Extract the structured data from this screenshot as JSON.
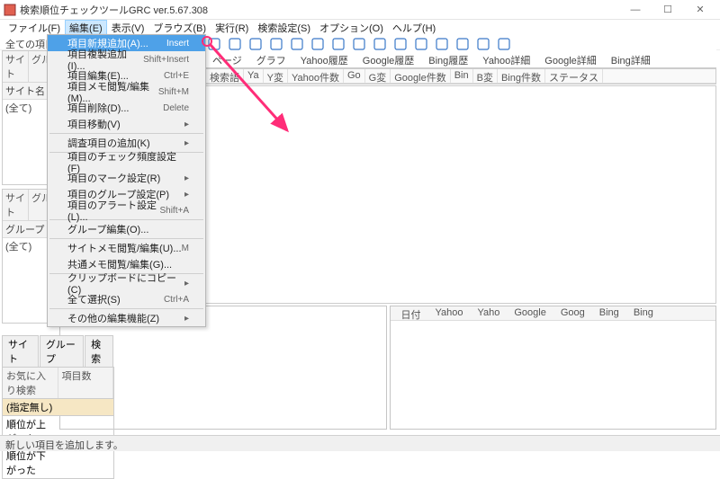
{
  "window": {
    "title": "検索順位チェックツールGRC  ver.5.67.308",
    "min": "—",
    "max": "☐",
    "close": "✕"
  },
  "menu": {
    "items": [
      "ファイル(F)",
      "編集(E)",
      "表示(V)",
      "ブラウズ(B)",
      "実行(R)",
      "検索設定(S)",
      "オプション(O)",
      "ヘルプ(H)"
    ],
    "active_index": 1
  },
  "infobar": "全ての項目",
  "edit_menu": [
    {
      "label": "項目新規追加(A)...",
      "shortcut": "Insert",
      "hl": true
    },
    {
      "label": "項目複製追加(I)...",
      "shortcut": "Shift+Insert"
    },
    {
      "label": "項目編集(E)...",
      "shortcut": "Ctrl+E"
    },
    {
      "label": "項目メモ閲覧/編集(M)...",
      "shortcut": "Shift+M"
    },
    {
      "label": "項目削除(D)...",
      "shortcut": "Delete"
    },
    {
      "label": "項目移動(V)",
      "arrow": true
    },
    {
      "sep": true
    },
    {
      "label": "調査項目の追加(K)",
      "arrow": true
    },
    {
      "sep": true
    },
    {
      "label": "項目のチェック頻度設定(F)"
    },
    {
      "label": "項目のマーク設定(R)",
      "arrow": true
    },
    {
      "label": "項目のグループ設定(P)",
      "arrow": true
    },
    {
      "label": "項目のアラート設定(L)...",
      "shortcut": "Shift+A"
    },
    {
      "sep": true
    },
    {
      "label": "グループ編集(O)..."
    },
    {
      "sep": true
    },
    {
      "label": "サイトメモ閲覧/編集(U)...",
      "shortcut": "M"
    },
    {
      "label": "共通メモ閲覧/編集(G)..."
    },
    {
      "sep": true
    },
    {
      "label": "クリップボードにコピー(C)",
      "arrow": true
    },
    {
      "label": "全て選択(S)",
      "shortcut": "Ctrl+A"
    },
    {
      "sep": true
    },
    {
      "label": "その他の編集機能(Z)",
      "arrow": true
    }
  ],
  "tabs": [
    "ページ",
    "グラフ",
    "Yahoo履歴",
    "Google履歴",
    "Bing履歴",
    "Yahoo詳細",
    "Google詳細",
    "Bing詳細"
  ],
  "grid_columns": [
    "検索語",
    "Ya",
    "Y変",
    "Yahoo件数",
    "Go",
    "G変",
    "Google件数",
    "Bin",
    "B変",
    "Bing件数",
    "ステータス"
  ],
  "left": {
    "top": {
      "hdr": [
        "サイト",
        "グル"
      ],
      "row": [
        "サイト名"
      ],
      "filter": "(全て)"
    },
    "mid": {
      "hdr": [
        "サイト",
        "グル"
      ],
      "row": [
        "グループ"
      ],
      "filter": "(全て)"
    }
  },
  "chart": {
    "cols": [
      "日付",
      "Yahoo",
      "Yaho",
      "Google",
      "Goog",
      "Bing",
      "Bing"
    ]
  },
  "fav": {
    "tabs": [
      "サイト",
      "グループ",
      "検索"
    ],
    "hdr": [
      "お気に入り検索",
      "項目数"
    ],
    "rows": [
      "(指定無し)",
      "順位が上がった",
      "順位が下がった"
    ]
  },
  "status": "新しい項目を追加します。"
}
